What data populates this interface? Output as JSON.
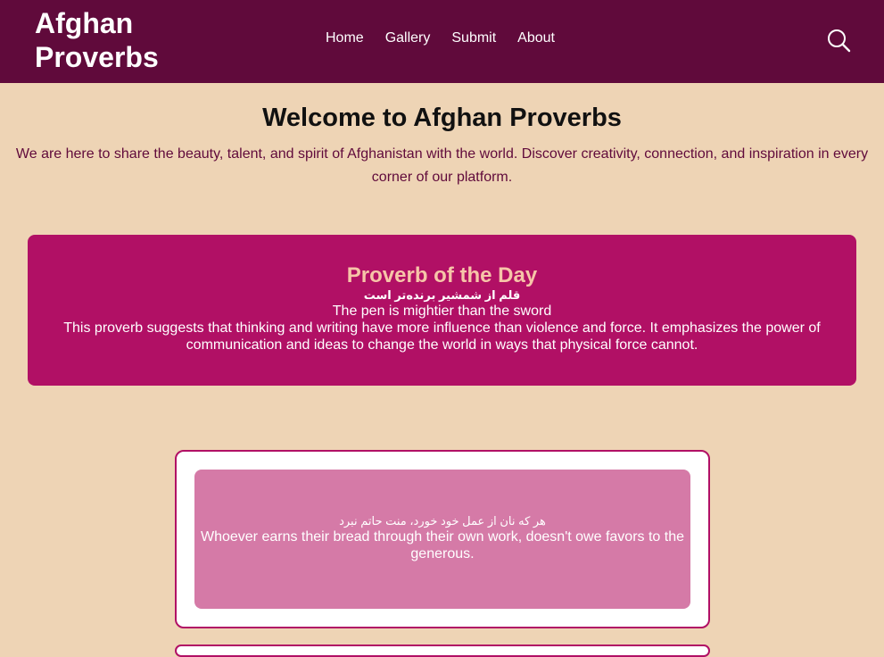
{
  "header": {
    "logo": "Afghan Proverbs",
    "nav": [
      "Home",
      "Gallery",
      "Submit",
      "About"
    ],
    "search_icon": "search-icon"
  },
  "welcome": {
    "title": "Welcome to Afghan Proverbs",
    "text": "We are here to share the beauty, talent, and spirit of Afghanistan with the world. Discover creativity, connection, and inspiration in every corner of our platform."
  },
  "proverb_of_the_day": {
    "title": "Proverb of the Day",
    "dari": "قلم از شمشیر برنده‌تر است",
    "english": "The pen is mightier than the sword",
    "meaning": "This proverb suggests that thinking and writing have more influence than violence and force. It emphasizes the power of communication and ideas to change the world in ways that physical force cannot."
  },
  "proverbs": [
    {
      "dari": "هر که نان از عمل خود خورد، منت حاتم نبرد",
      "english": "Whoever earns their bread through their own work, doesn't owe favors to the generous."
    }
  ],
  "colors": {
    "header_bg": "#600a3b",
    "page_bg": "#eed4b5",
    "accent": "#b11065",
    "card_inner": "#d57aa7",
    "potd_title": "#f6c5a8"
  }
}
